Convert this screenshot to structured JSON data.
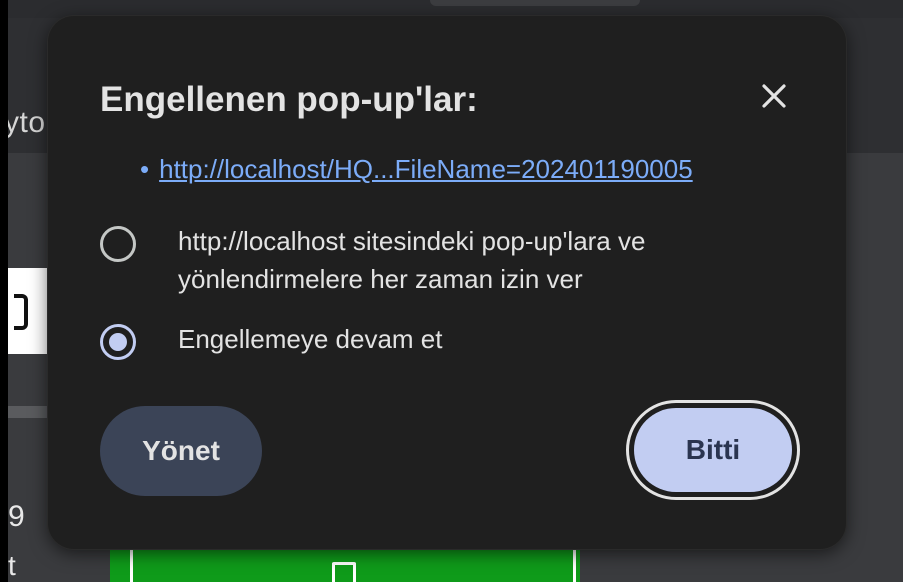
{
  "background": {
    "tab_text": "yto",
    "side_number": "9",
    "side_letter": "t"
  },
  "popup": {
    "title": "Engellenen pop-up'lar:",
    "bullet": "•",
    "blocked_url": "http://localhost/HQ...FileName=202401190005",
    "options": [
      {
        "line1": "http://localhost sitesindeki pop-up'lara ve",
        "line2": "yönlendirmelere her zaman izin ver",
        "selected": false
      },
      {
        "line1": "Engellemeye devam et",
        "selected": true
      }
    ],
    "manage_label": "Yönet",
    "done_label": "Bitti"
  },
  "colors": {
    "bubble_bg": "#1f1f1f",
    "link": "#7cacf8",
    "primary_button": "#c2cdf2",
    "tonal_button": "#3b4457",
    "green_bar": "#0f9b1a"
  },
  "icons": {
    "close": "close-icon",
    "radio_unchecked": "radio-unchecked-icon",
    "radio_checked": "radio-checked-icon",
    "document": "document-icon"
  }
}
